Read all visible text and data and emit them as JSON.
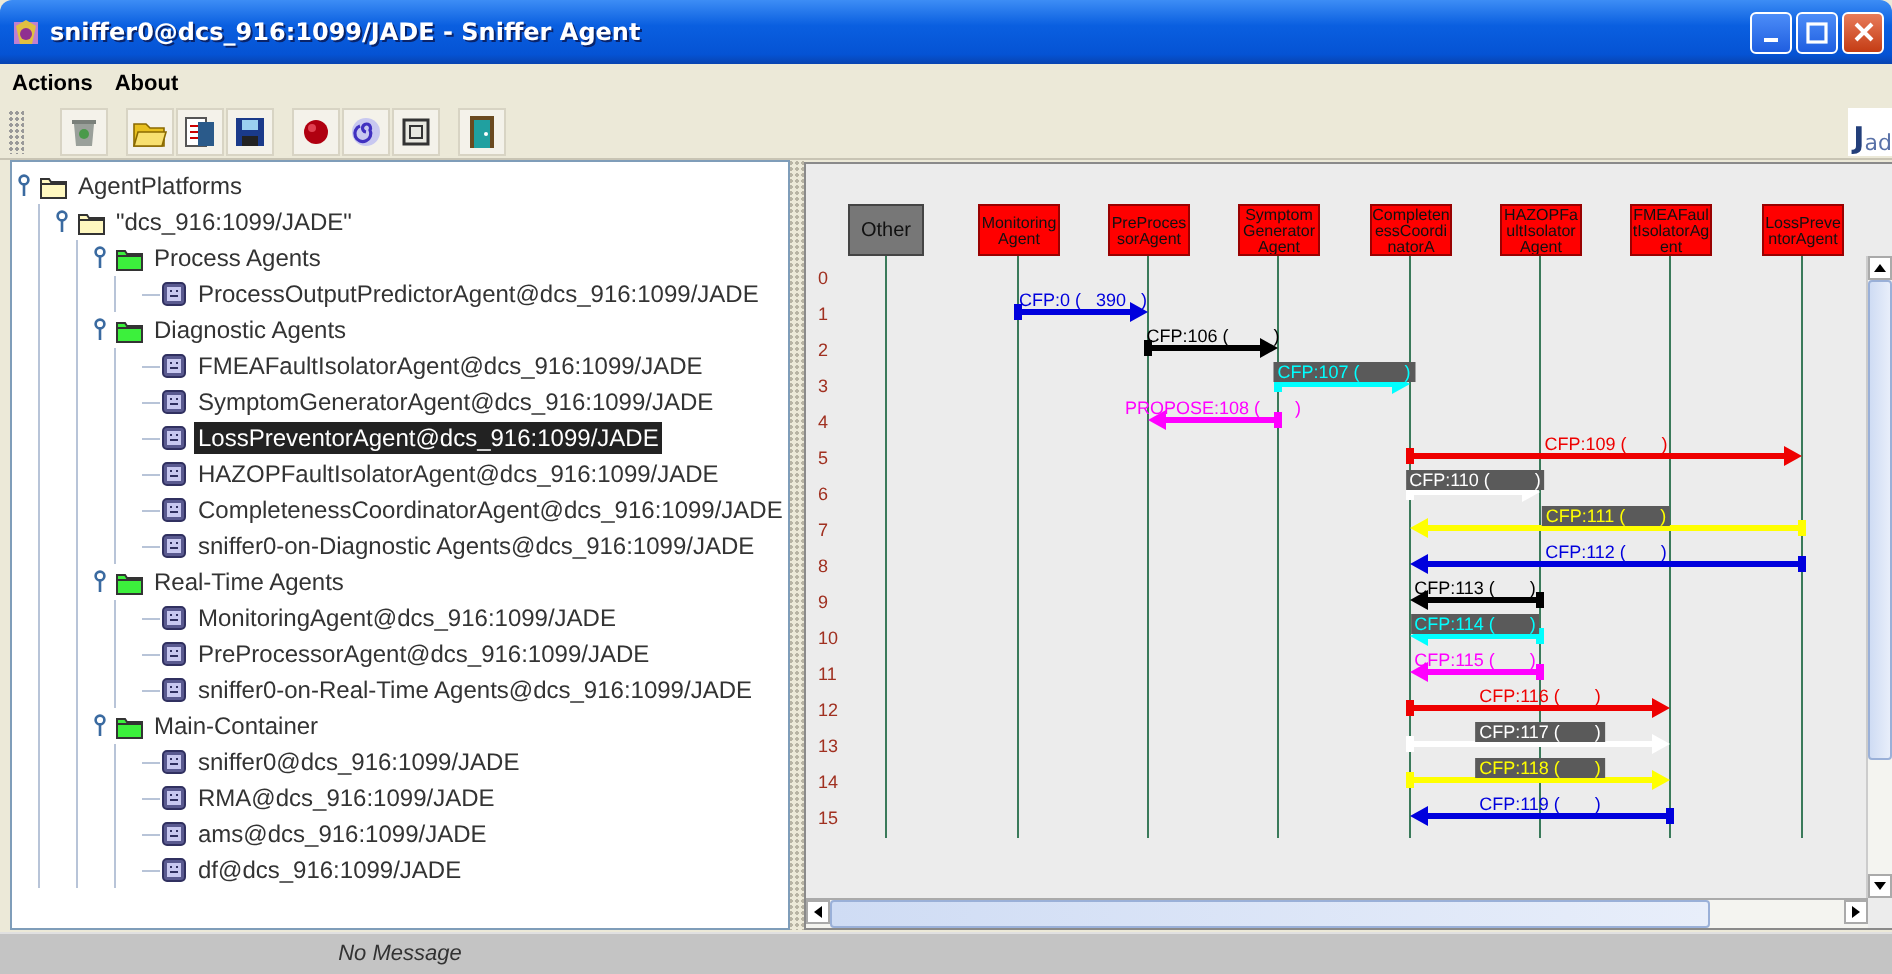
{
  "window": {
    "title": "sniffer0@dcs_916:1099/JADE - Sniffer Agent"
  },
  "menu": [
    "Actions",
    "About"
  ],
  "logo": "Jad",
  "tree": [
    {
      "label": "AgentPlatforms",
      "kind": "platform",
      "expanded": true,
      "children": [
        {
          "label": "\"dcs_916:1099/JADE\"",
          "kind": "platform",
          "expanded": true,
          "children": [
            {
              "label": "Process Agents",
              "kind": "container",
              "expanded": true,
              "children": [
                {
                  "label": "ProcessOutputPredictorAgent@dcs_916:1099/JADE",
                  "kind": "agent",
                  "selected": false
                }
              ]
            },
            {
              "label": "Diagnostic Agents",
              "kind": "container",
              "expanded": true,
              "children": [
                {
                  "label": "FMEAFaultIsolatorAgent@dcs_916:1099/JADE",
                  "kind": "agent",
                  "selected": false
                },
                {
                  "label": "SymptomGeneratorAgent@dcs_916:1099/JADE",
                  "kind": "agent",
                  "selected": false
                },
                {
                  "label": "LossPreventorAgent@dcs_916:1099/JADE",
                  "kind": "agent",
                  "selected": true
                },
                {
                  "label": "HAZOPFaultIsolatorAgent@dcs_916:1099/JADE",
                  "kind": "agent",
                  "selected": false
                },
                {
                  "label": "CompletenessCoordinatorAgent@dcs_916:1099/JADE",
                  "kind": "agent",
                  "selected": false
                },
                {
                  "label": "sniffer0-on-Diagnostic Agents@dcs_916:1099/JADE",
                  "kind": "agent",
                  "selected": false
                }
              ]
            },
            {
              "label": "Real-Time Agents",
              "kind": "container",
              "expanded": true,
              "children": [
                {
                  "label": "MonitoringAgent@dcs_916:1099/JADE",
                  "kind": "agent",
                  "selected": false
                },
                {
                  "label": "PreProcessorAgent@dcs_916:1099/JADE",
                  "kind": "agent",
                  "selected": false
                },
                {
                  "label": "sniffer0-on-Real-Time Agents@dcs_916:1099/JADE",
                  "kind": "agent",
                  "selected": false
                }
              ]
            },
            {
              "label": "Main-Container",
              "kind": "container",
              "expanded": true,
              "children": [
                {
                  "label": "sniffer0@dcs_916:1099/JADE",
                  "kind": "agent",
                  "selected": false
                },
                {
                  "label": "RMA@dcs_916:1099/JADE",
                  "kind": "agent",
                  "selected": false
                },
                {
                  "label": "ams@dcs_916:1099/JADE",
                  "kind": "agent",
                  "selected": false
                },
                {
                  "label": "df@dcs_916:1099/JADE",
                  "kind": "agent",
                  "selected": false
                }
              ]
            }
          ]
        }
      ]
    }
  ],
  "sniffer": {
    "agents": [
      {
        "name": "Other",
        "kind": "other"
      },
      {
        "name": "MonitoringAgent",
        "kind": "agent"
      },
      {
        "name": "PreProcessorAgent",
        "kind": "agent"
      },
      {
        "name": "SymptomGeneratorAgent",
        "kind": "agent"
      },
      {
        "name": "CompletenessCoordinatorA",
        "kind": "agent"
      },
      {
        "name": "HAZOPFaultIsolatorAgent",
        "kind": "agent"
      },
      {
        "name": "FMEAFaultIsolatorAgent",
        "kind": "agent"
      },
      {
        "name": "LossPreventorAgent",
        "kind": "agent"
      }
    ],
    "row_numbers": [
      "0",
      "1",
      "2",
      "3",
      "4",
      "5",
      "6",
      "7",
      "8",
      "9",
      "10",
      "11",
      "12",
      "13",
      "14",
      "15"
    ],
    "messages": [
      {
        "label": "CFP:0 (   390   )",
        "color": "#0000dd"
      },
      {
        "label": "CFP:106 (         )",
        "color": "#000000"
      },
      {
        "label": "CFP:107 (         )",
        "color": "#00ffff"
      },
      {
        "label": "PROPOSE:108 (       )",
        "color": "#ff00ff"
      },
      {
        "label": "CFP:109 (       )",
        "color": "#ee0000"
      },
      {
        "label": "CFP:110 (         )",
        "color": "#ffffff"
      },
      {
        "label": "CFP:111 (       )",
        "color": "#ffff00"
      },
      {
        "label": "CFP:112 (       )",
        "color": "#0000dd"
      },
      {
        "label": "CFP:113 (       )",
        "color": "#000000"
      },
      {
        "label": "CFP:114 (       )",
        "color": "#00ffff"
      },
      {
        "label": "CFP:115 (       )",
        "color": "#ff00ff"
      },
      {
        "label": "CFP:116 (       )",
        "color": "#ee0000"
      },
      {
        "label": "CFP:117 (       )",
        "color": "#ffffff"
      },
      {
        "label": "CFP:118 (       )",
        "color": "#ffff00"
      },
      {
        "label": "CFP:119 (       )",
        "color": "#0000dd"
      }
    ]
  },
  "status_bar": "No Message"
}
